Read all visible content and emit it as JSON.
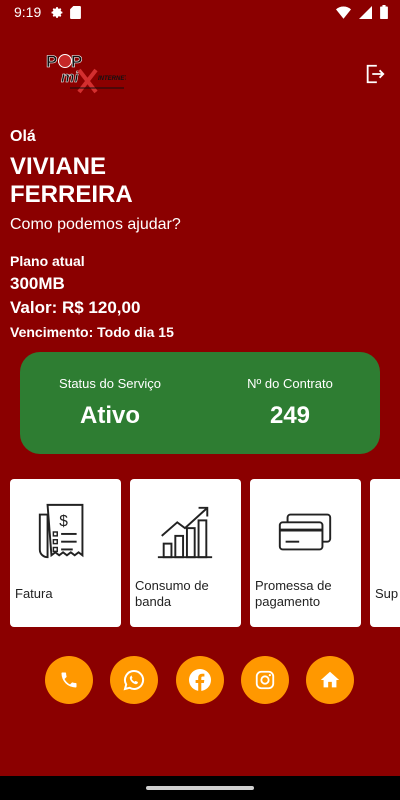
{
  "statusbar": {
    "time": "9:19",
    "icons": [
      "gear-icon",
      "sd-card-icon"
    ],
    "right_icons": [
      "wifi-icon",
      "signal-icon",
      "battery-icon"
    ]
  },
  "logo": {
    "text_top": "POP",
    "text_mix": "MIX",
    "text_small": "INTERNET",
    "alt": "Pop Mix Internet"
  },
  "header": {
    "logout_icon": "logout-icon"
  },
  "user": {
    "greeting": "Olá",
    "name": "VIVIANE FERREIRA",
    "prompt": "Como podemos ajudar?"
  },
  "plan": {
    "label": "Plano atual",
    "speed": "300MB",
    "value": "Valor: R$ 120,00",
    "due": "Vencimento: Todo dia 15"
  },
  "status_card": {
    "service_label": "Status do Serviço",
    "service_value": "Ativo",
    "contract_label": "Nº do Contrato",
    "contract_value": "249",
    "color": "#2e7d32"
  },
  "cards": [
    {
      "label": "Fatura",
      "icon": "invoice-icon"
    },
    {
      "label": "Consumo de banda",
      "icon": "growth-chart-icon"
    },
    {
      "label": "Promessa de pagamento",
      "icon": "credit-card-icon"
    },
    {
      "label": "Sup",
      "icon": "support-icon"
    }
  ],
  "actions": [
    {
      "icon": "phone-icon"
    },
    {
      "icon": "whatsapp-icon"
    },
    {
      "icon": "facebook-icon"
    },
    {
      "icon": "instagram-icon"
    },
    {
      "icon": "home-icon"
    }
  ],
  "colors": {
    "background": "#8b0000",
    "accent": "#ff9800",
    "card": "#ffffff"
  }
}
